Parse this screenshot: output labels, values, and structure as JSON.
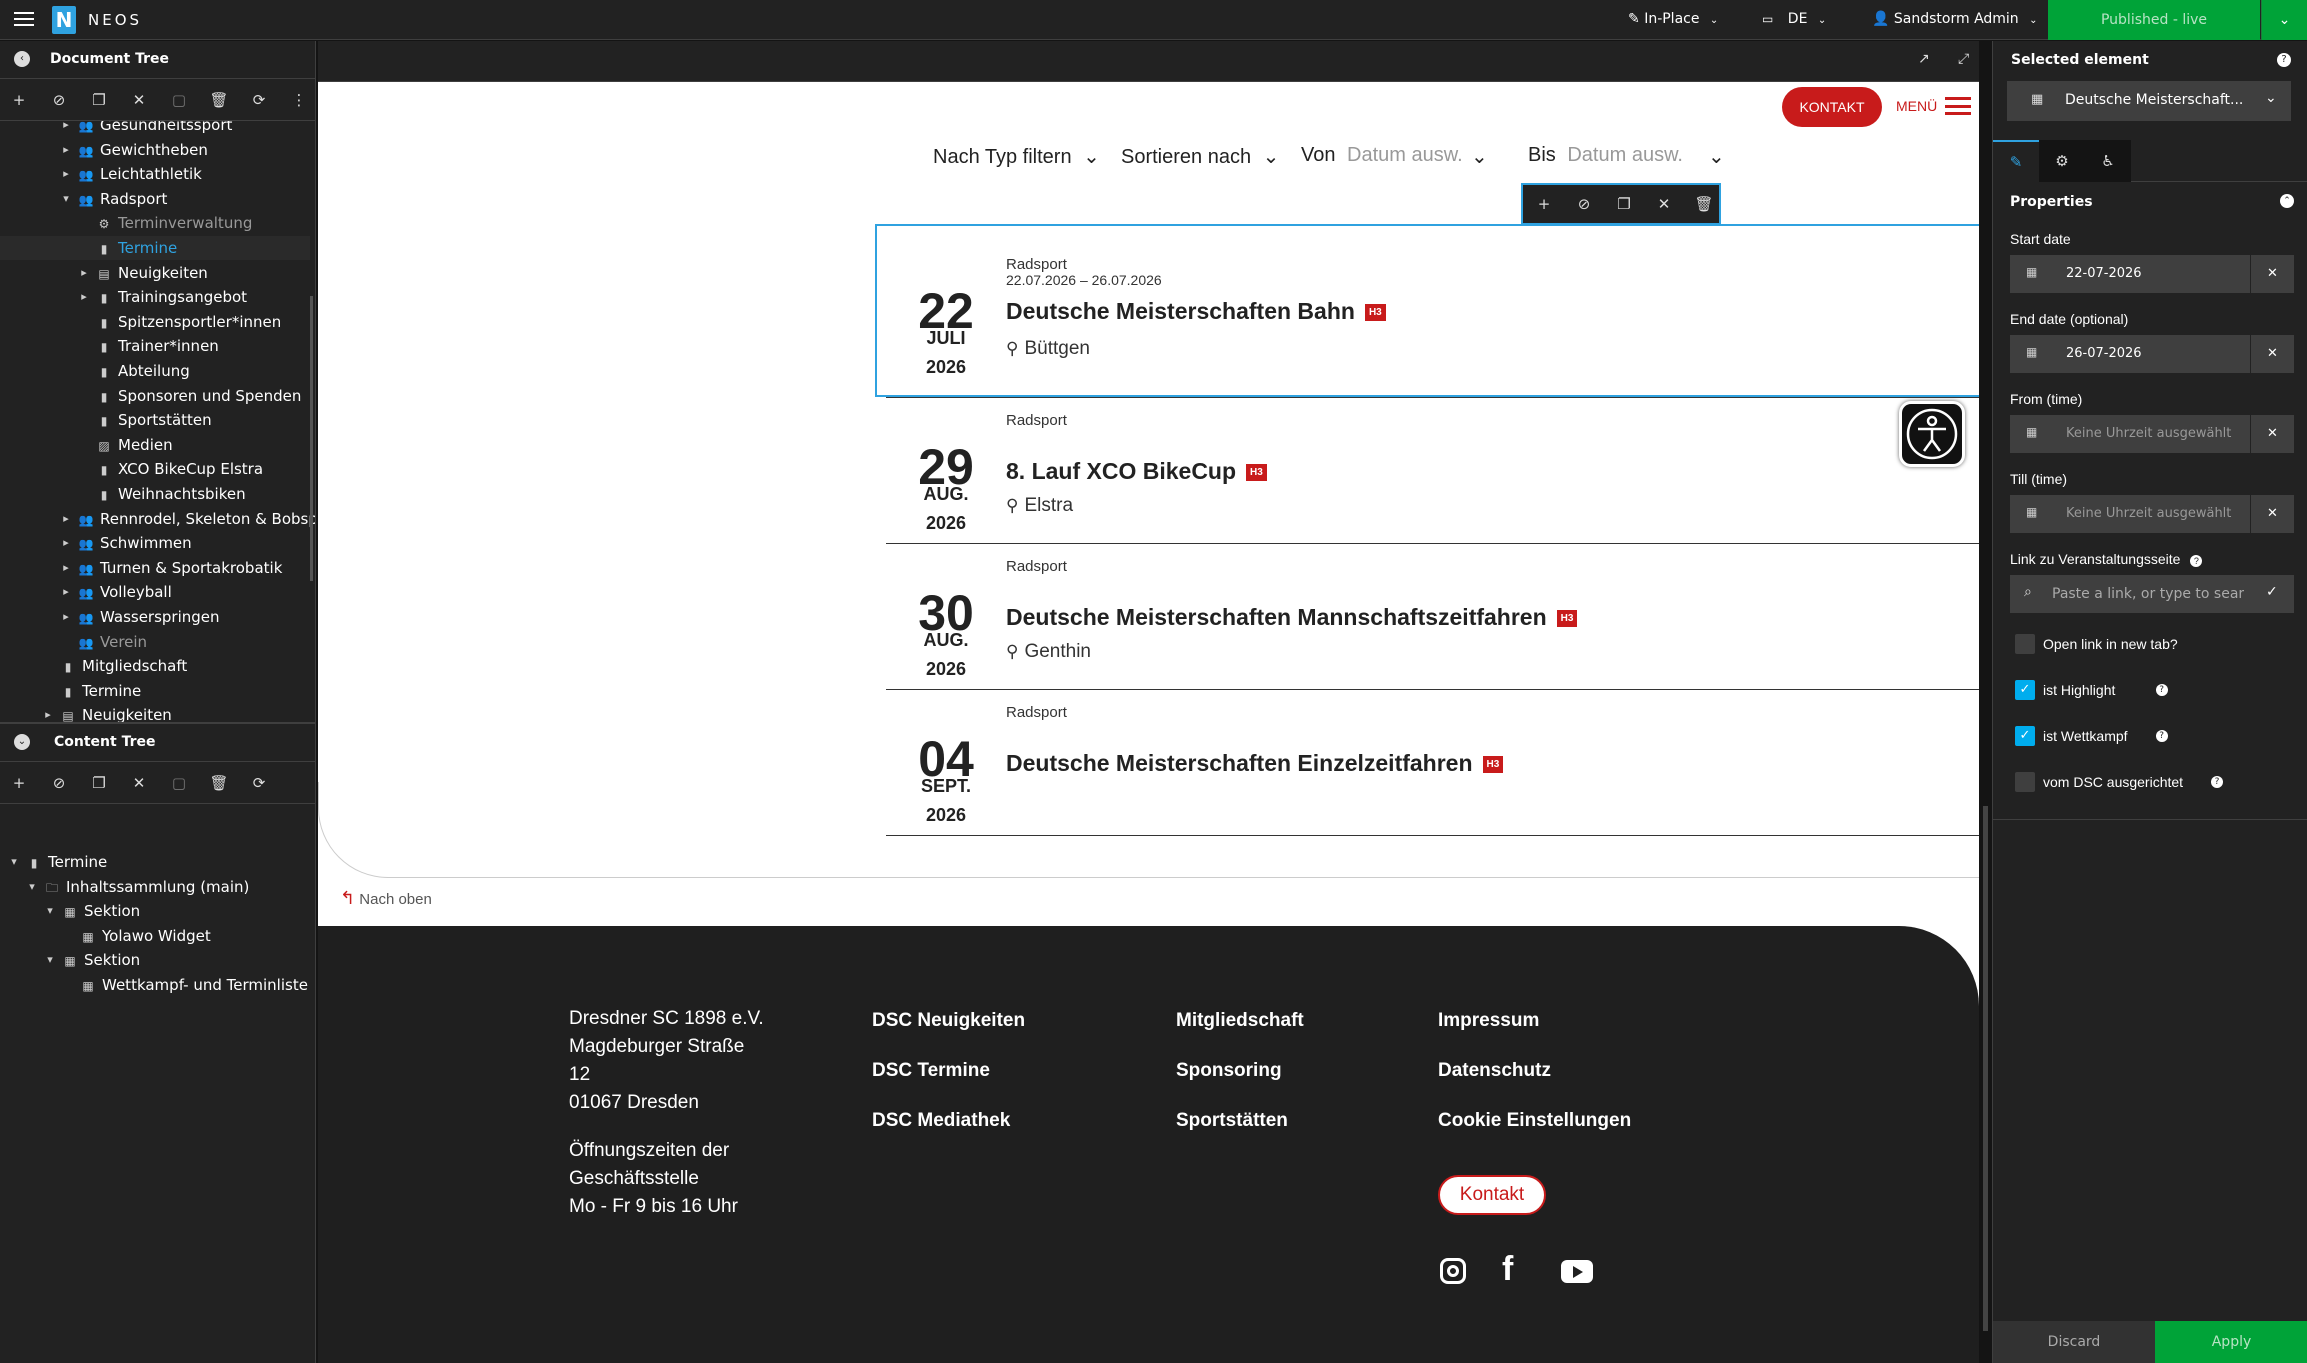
{
  "topbar": {
    "brand": "NEOS",
    "edit_mode": "In-Place",
    "dimension": "DE",
    "user": "Sandstorm Admin",
    "publish_status": "Published - live"
  },
  "document_tree": {
    "title": "Document Tree",
    "items": [
      {
        "label": "Gesundheitssport",
        "indent": 2,
        "icon": "group",
        "arrow": "right"
      },
      {
        "label": "Gewichtheben",
        "indent": 2,
        "icon": "group",
        "arrow": "right"
      },
      {
        "label": "Leichtathletik",
        "indent": 2,
        "icon": "group",
        "arrow": "right"
      },
      {
        "label": "Radsport",
        "indent": 2,
        "icon": "group",
        "arrow": "down"
      },
      {
        "label": "Terminverwaltung",
        "indent": 3,
        "icon": "gear",
        "arrow": "",
        "state": "hidden"
      },
      {
        "label": "Termine",
        "indent": 3,
        "icon": "doc",
        "arrow": "",
        "state": "active"
      },
      {
        "label": "Neuigkeiten",
        "indent": 3,
        "icon": "news",
        "arrow": "right"
      },
      {
        "label": "Trainingsangebot",
        "indent": 3,
        "icon": "doc",
        "arrow": "right"
      },
      {
        "label": "Spitzensportler*innen",
        "indent": 3,
        "icon": "doc",
        "arrow": ""
      },
      {
        "label": "Trainer*innen",
        "indent": 3,
        "icon": "doc",
        "arrow": ""
      },
      {
        "label": "Abteilung",
        "indent": 3,
        "icon": "doc",
        "arrow": ""
      },
      {
        "label": "Sponsoren und Spenden",
        "indent": 3,
        "icon": "doc",
        "arrow": ""
      },
      {
        "label": "Sportstätten",
        "indent": 3,
        "icon": "doc",
        "arrow": ""
      },
      {
        "label": "Medien",
        "indent": 3,
        "icon": "media",
        "arrow": ""
      },
      {
        "label": "XCO BikeCup Elstra",
        "indent": 3,
        "icon": "doc",
        "arrow": ""
      },
      {
        "label": "Weihnachtsbiken",
        "indent": 3,
        "icon": "doc",
        "arrow": ""
      },
      {
        "label": "Rennrodel, Skeleton & Bobsport",
        "indent": 2,
        "icon": "group",
        "arrow": "right"
      },
      {
        "label": "Schwimmen",
        "indent": 2,
        "icon": "group",
        "arrow": "right"
      },
      {
        "label": "Turnen & Sportakrobatik",
        "indent": 2,
        "icon": "group",
        "arrow": "right"
      },
      {
        "label": "Volleyball",
        "indent": 2,
        "icon": "group",
        "arrow": "right"
      },
      {
        "label": "Wasserspringen",
        "indent": 2,
        "icon": "group",
        "arrow": "right"
      },
      {
        "label": "Verein",
        "indent": 2,
        "icon": "group",
        "arrow": "",
        "state": "hidden"
      },
      {
        "label": "Mitgliedschaft",
        "indent": 1,
        "icon": "doc",
        "arrow": ""
      },
      {
        "label": "Termine",
        "indent": 1,
        "icon": "doc",
        "arrow": ""
      },
      {
        "label": "Neuigkeiten",
        "indent": 1,
        "icon": "news",
        "arrow": "right"
      }
    ]
  },
  "content_tree": {
    "title": "Content Tree",
    "items": [
      {
        "label": "Termine",
        "indent": 0,
        "icon": "doc",
        "arrow": "down"
      },
      {
        "label": "Inhaltssammlung (main)",
        "indent": 1,
        "icon": "folder",
        "arrow": "down"
      },
      {
        "label": "Sektion",
        "indent": 2,
        "icon": "section",
        "arrow": "down"
      },
      {
        "label": "Yolawo Widget",
        "indent": 3,
        "icon": "calendar",
        "arrow": ""
      },
      {
        "label": "Sektion",
        "indent": 2,
        "icon": "section",
        "arrow": "down"
      },
      {
        "label": "Wettkampf- und Terminliste",
        "indent": 3,
        "icon": "calendar",
        "arrow": ""
      }
    ]
  },
  "site": {
    "kontakt_button": "KONTAKT",
    "menu_label": "MENÜ",
    "filters": {
      "type": "Nach Typ filtern",
      "sort": "Sortieren nach",
      "from_label": "Von",
      "from_placeholder": "Datum ausw.",
      "to_label": "Bis",
      "to_placeholder": "Datum ausw."
    },
    "events": [
      {
        "day": "22",
        "month": "JULI",
        "year": "2026",
        "category": "Radsport",
        "range": "22.07.2026 – 26.07.2026",
        "title": "Deutsche Meisterschaften Bahn",
        "tag": "H3",
        "location": "Büttgen"
      },
      {
        "day": "29",
        "month": "AUG.",
        "year": "2026",
        "category": "Radsport",
        "range": "",
        "title": "8. Lauf XCO BikeCup",
        "tag": "H3",
        "location": "Elstra"
      },
      {
        "day": "30",
        "month": "AUG.",
        "year": "2026",
        "category": "Radsport",
        "range": "",
        "title": "Deutsche Meisterschaften Mannschaftszeitfahren",
        "tag": "H3",
        "location": "Genthin"
      },
      {
        "day": "04",
        "month": "SEPT.",
        "year": "2026",
        "category": "Radsport",
        "range": "",
        "title": "Deutsche Meisterschaften Einzelzeitfahren",
        "tag": "H3",
        "location": ""
      }
    ],
    "back_to_top": "Nach oben",
    "footer": {
      "address": [
        "Dresdner SC 1898 e.V.",
        "Magdeburger Straße",
        "12",
        "01067 Dresden"
      ],
      "hours": [
        "Öffnungszeiten der",
        "Geschäftsstelle",
        "Mo - Fr 9 bis 16 Uhr"
      ],
      "col2": [
        "DSC Neuigkeiten",
        "DSC Termine",
        "DSC Mediathek"
      ],
      "col3": [
        "Mitgliedschaft",
        "Sponsoring",
        "Sportstätten"
      ],
      "col4": [
        "Impressum",
        "Datenschutz",
        "Cookie Einstellungen"
      ],
      "kontakt": "Kontakt"
    }
  },
  "inspector": {
    "title": "Selected element",
    "selected": "Deutsche Meisterschaft...",
    "section": "Properties",
    "start_label": "Start date",
    "start_value": "22-07-2026",
    "end_label": "End date (optional)",
    "end_value": "26-07-2026",
    "from_label": "From (time)",
    "from_placeholder": "Keine Uhrzeit ausgewählt",
    "till_label": "Till (time)",
    "till_placeholder": "Keine Uhrzeit ausgewählt",
    "link_label": "Link zu Veranstaltungsseite",
    "link_placeholder": "Paste a link, or type to search",
    "checks": [
      {
        "label": "Open link in new tab?",
        "checked": false,
        "help": false
      },
      {
        "label": "ist Highlight",
        "checked": true,
        "help": true
      },
      {
        "label": "ist Wettkampf",
        "checked": true,
        "help": true
      },
      {
        "label": "vom DSC ausgerichtet",
        "checked": false,
        "help": true
      }
    ],
    "discard": "Discard",
    "apply": "Apply"
  },
  "colors": {
    "accent": "#00a338",
    "brand_red": "#c81b1b",
    "neos_blue": "#2fa2e0"
  }
}
